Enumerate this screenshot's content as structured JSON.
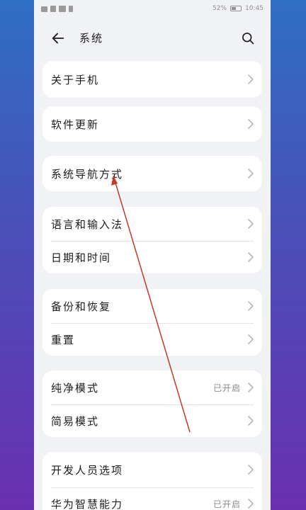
{
  "status_bar": {
    "battery_percent": "52%",
    "time": "10:45",
    "icons": [
      "hd-icon",
      "signal-icon",
      "signal-icon",
      "vibrate-icon"
    ]
  },
  "header": {
    "title": "系统",
    "back_icon": "arrow-left-icon",
    "search_icon": "search-icon"
  },
  "groups": [
    {
      "items": [
        {
          "label": "关于手机",
          "value": ""
        }
      ]
    },
    {
      "items": [
        {
          "label": "软件更新",
          "value": ""
        }
      ]
    },
    {
      "items": [
        {
          "label": "系统导航方式",
          "value": ""
        }
      ]
    },
    {
      "items": [
        {
          "label": "语言和输入法",
          "value": ""
        },
        {
          "label": "日期和时间",
          "value": ""
        }
      ]
    },
    {
      "items": [
        {
          "label": "备份和恢复",
          "value": ""
        },
        {
          "label": "重置",
          "value": ""
        }
      ]
    },
    {
      "items": [
        {
          "label": "纯净模式",
          "value": "已开启"
        },
        {
          "label": "简易模式",
          "value": ""
        }
      ]
    },
    {
      "items": [
        {
          "label": "开发人员选项",
          "value": ""
        },
        {
          "label": "华为智慧能力",
          "value": "已开启"
        }
      ]
    }
  ],
  "colors": {
    "background_gradient_top": "#2f6fc2",
    "background_gradient_bottom": "#6a2fb0",
    "screen_bg": "#f1f2f5",
    "card_bg": "#ffffff",
    "annotation_line": "#c0392b"
  }
}
